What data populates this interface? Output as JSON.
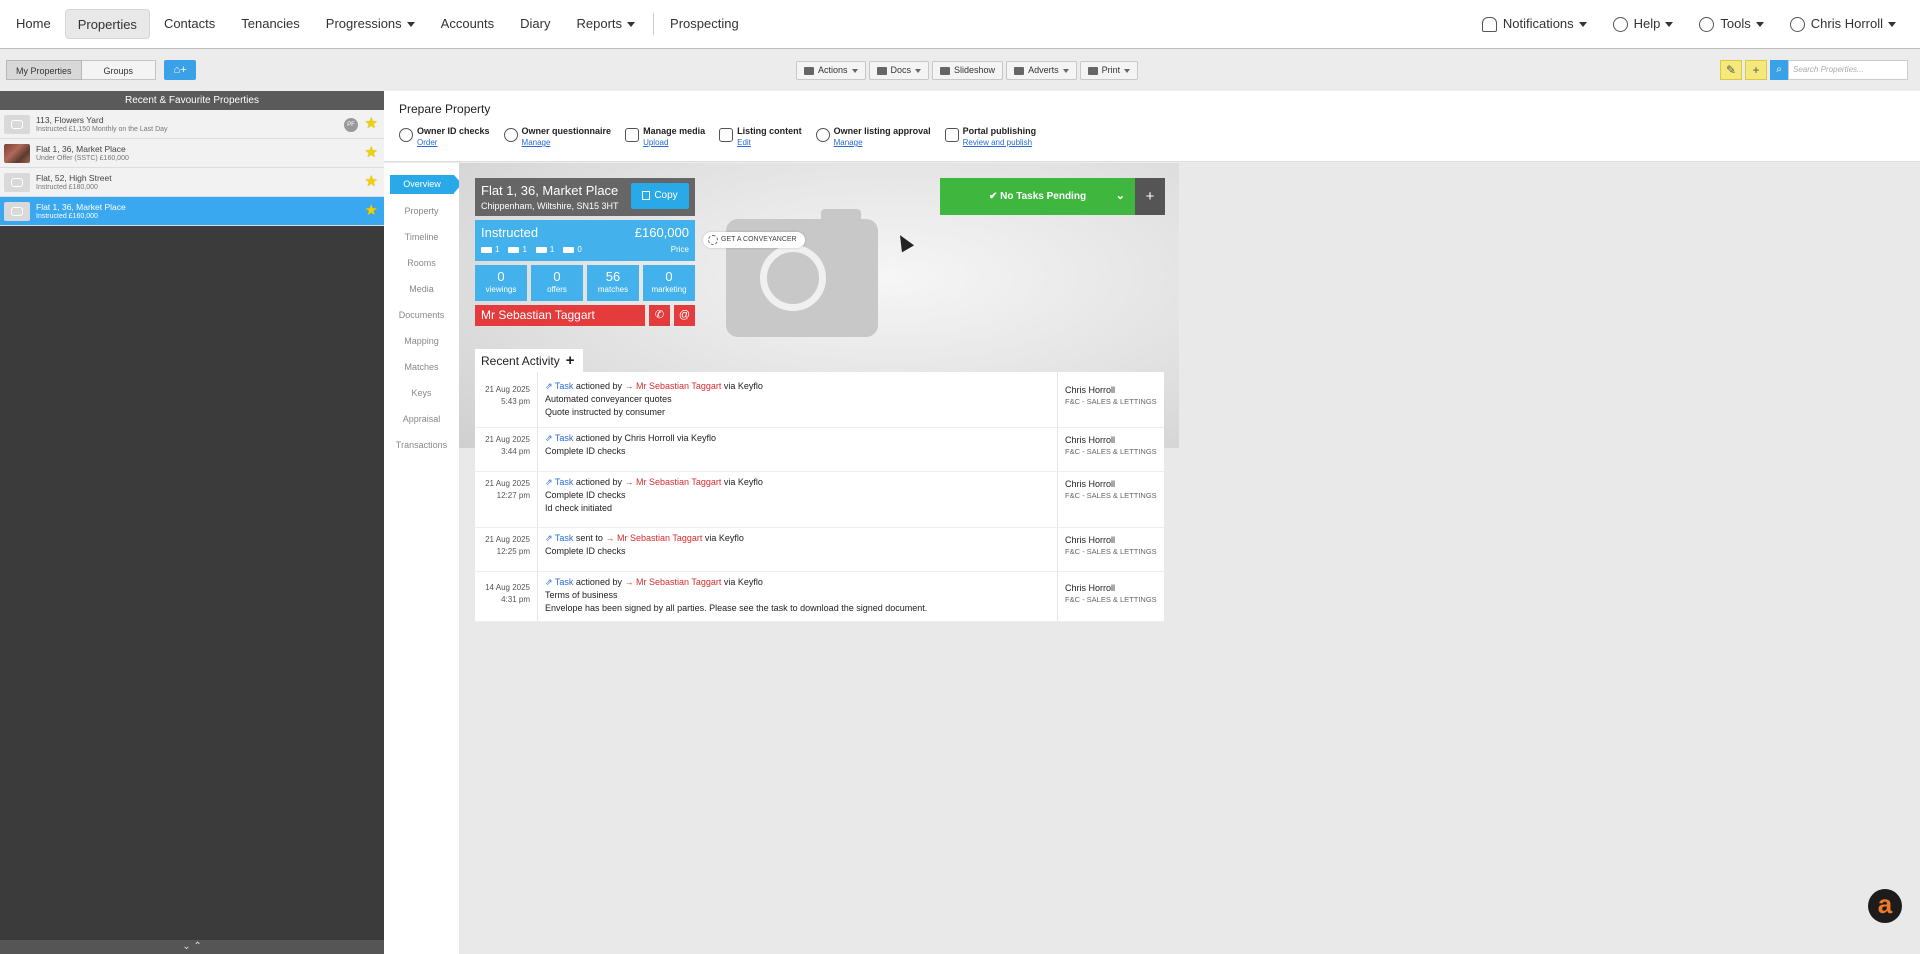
{
  "nav": {
    "items": [
      {
        "label": "Home",
        "caret": false
      },
      {
        "label": "Properties",
        "caret": false,
        "active": true
      },
      {
        "label": "Contacts",
        "caret": false
      },
      {
        "label": "Tenancies",
        "caret": false
      },
      {
        "label": "Progressions",
        "caret": true
      },
      {
        "label": "Accounts",
        "caret": false
      },
      {
        "label": "Diary",
        "caret": false
      },
      {
        "label": "Reports",
        "caret": true
      },
      {
        "label": "Prospecting",
        "caret": false
      }
    ],
    "right": {
      "notifications": "Notifications",
      "help": "Help",
      "tools": "Tools",
      "user": "Chris Horroll"
    }
  },
  "toolbar": {
    "my_properties": "My Properties",
    "groups": "Groups",
    "actions": "Actions",
    "docs": "Docs",
    "slideshow": "Slideshow",
    "adverts": "Adverts",
    "print": "Print",
    "search_placeholder": "Search Properties..."
  },
  "sidebar": {
    "title": "Recent & Favourite Properties",
    "properties": [
      {
        "name": "113, Flowers Yard",
        "status": "Instructed £1,150 Monthly on the Last Day",
        "badge": "PF"
      },
      {
        "name": "Flat 1, 36, Market Place",
        "status": "Under Offer (SSTC) £160,000"
      },
      {
        "name": "Flat, 52, High Street",
        "status": "Instructed £180,000"
      },
      {
        "name": "Flat 1, 36, Market Place",
        "status": "Instructed £160,000"
      }
    ]
  },
  "prepare": {
    "title": "Prepare Property",
    "steps": [
      {
        "title": "Owner ID checks",
        "link": "Order"
      },
      {
        "title": "Owner questionnaire",
        "link": "Manage"
      },
      {
        "title": "Manage media",
        "link": "Upload"
      },
      {
        "title": "Listing content",
        "link": "Edit"
      },
      {
        "title": "Owner listing approval",
        "link": "Manage"
      },
      {
        "title": "Portal publishing",
        "link": "Review and publish"
      }
    ]
  },
  "subnav": [
    "Overview",
    "Property",
    "Timeline",
    "Rooms",
    "Media",
    "Documents",
    "Mapping",
    "Matches",
    "Keys",
    "Appraisal",
    "Transactions"
  ],
  "property": {
    "address_line1": "Flat 1, 36, Market Place",
    "address_line2": "Chippenham, Wiltshire, SN15 3HT",
    "copy": "Copy",
    "status": "Instructed",
    "price": "£160,000",
    "price_label": "Price",
    "features": {
      "bedrooms": "1",
      "bathrooms": "1",
      "receptions": "1",
      "parking": "0"
    },
    "stats": [
      {
        "value": "0",
        "label": "viewings"
      },
      {
        "value": "0",
        "label": "offers"
      },
      {
        "value": "56",
        "label": "matches"
      },
      {
        "value": "0",
        "label": "marketing"
      }
    ],
    "owner": "Mr Sebastian Taggart",
    "conveyancer": "GET A CONVEYANCER",
    "tasks": "No Tasks Pending"
  },
  "activity": {
    "title": "Recent Activity",
    "items": [
      {
        "date": "21 Aug 2025",
        "time": "5:43 pm",
        "task": "Task",
        "verb": "actioned by",
        "person": "Mr Sebastian Taggart",
        "via": "via Keyflo",
        "lines": [
          "Automated conveyancer quotes",
          "Quote instructed by consumer"
        ],
        "who": "Chris Horroll",
        "dept": "F&C - SALES & LETTINGS"
      },
      {
        "date": "21 Aug 2025",
        "time": "3:44 pm",
        "task": "Task",
        "verb": "actioned by Chris Horroll via Keyflo",
        "person": "",
        "via": "",
        "lines": [
          "Complete ID checks"
        ],
        "who": "Chris Horroll",
        "dept": "F&C - SALES & LETTINGS"
      },
      {
        "date": "21 Aug 2025",
        "time": "12:27 pm",
        "task": "Task",
        "verb": "actioned by",
        "person": "Mr Sebastian Taggart",
        "via": "via Keyflo",
        "lines": [
          "Complete ID checks",
          "Id check initiated"
        ],
        "who": "Chris Horroll",
        "dept": "F&C - SALES & LETTINGS"
      },
      {
        "date": "21 Aug 2025",
        "time": "12:25 pm",
        "task": "Task",
        "verb": "sent to",
        "person": "Mr Sebastian Taggart",
        "via": "via Keyflo",
        "lines": [
          "Complete ID checks"
        ],
        "who": "Chris Horroll",
        "dept": "F&C - SALES & LETTINGS"
      },
      {
        "date": "14 Aug 2025",
        "time": "4:31 pm",
        "task": "Task",
        "verb": "actioned by",
        "person": "Mr Sebastian Taggart",
        "via": "via Keyflo",
        "lines": [
          "Terms of business",
          "Envelope has been signed by all parties. Please see the task to download the signed document."
        ],
        "who": "Chris Horroll",
        "dept": "F&C - SALES & LETTINGS"
      }
    ]
  },
  "colors": {
    "accent": "#29a9e8",
    "green": "#3fb73f",
    "red": "#e43c3c"
  }
}
